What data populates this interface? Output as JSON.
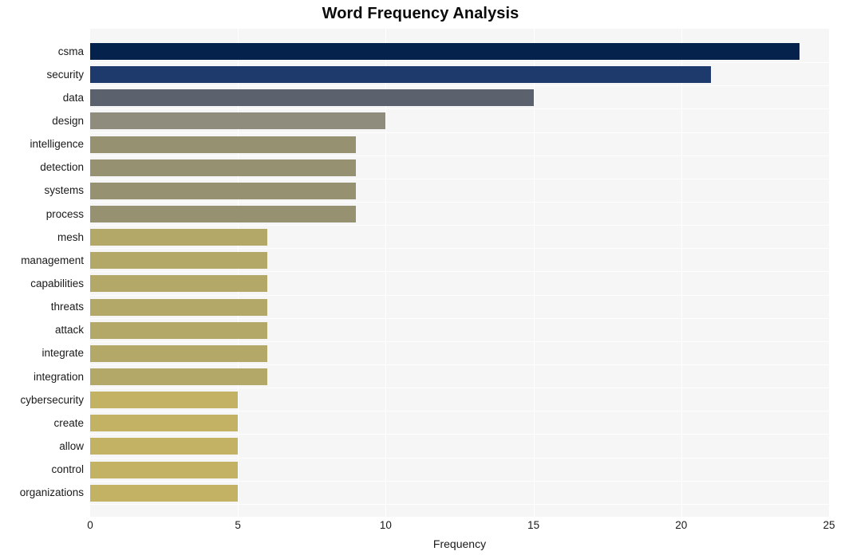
{
  "chart_data": {
    "type": "bar",
    "orientation": "horizontal",
    "title": "Word Frequency Analysis",
    "xlabel": "Frequency",
    "ylabel": "",
    "xlim": [
      0,
      25
    ],
    "xticks": [
      0,
      5,
      10,
      15,
      20,
      25
    ],
    "xtick_labels": [
      "0",
      "5",
      "10",
      "15",
      "20",
      "25"
    ],
    "grid": true,
    "legend": "none",
    "categories": [
      "csma",
      "security",
      "data",
      "design",
      "intelligence",
      "detection",
      "systems",
      "process",
      "mesh",
      "management",
      "capabilities",
      "threats",
      "attack",
      "integrate",
      "integration",
      "cybersecurity",
      "create",
      "allow",
      "control",
      "organizations"
    ],
    "values": [
      24,
      21,
      15,
      10,
      9,
      9,
      9,
      9,
      6,
      6,
      6,
      6,
      6,
      6,
      6,
      5,
      5,
      5,
      5,
      5
    ],
    "bar_colors": [
      "#04224c",
      "#1e3a6d",
      "#5c616e",
      "#908c7d",
      "#969170",
      "#969170",
      "#969170",
      "#969170",
      "#b4a868",
      "#b4a868",
      "#b4a868",
      "#b4a868",
      "#b4a868",
      "#b4a868",
      "#b4a868",
      "#c4b264",
      "#c4b264",
      "#c4b264",
      "#c4b264",
      "#c4b264"
    ],
    "plot_background": "#f6f6f6",
    "gridline_color": "#ffffff",
    "figure_background": "#ffffff"
  }
}
